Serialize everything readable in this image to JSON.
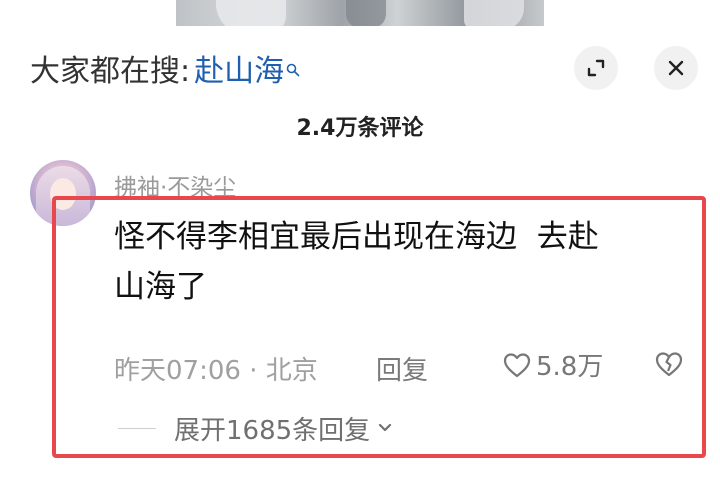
{
  "search_header": {
    "prefix": "大家都在搜:",
    "keyword": "赴山海",
    "icons": [
      "search-icon",
      "expand-icon",
      "close-icon"
    ]
  },
  "comment_count": "2.4万条评论",
  "comment": {
    "username": "拂袖·不染尘",
    "text": "怪不得李相宜最后出现在海边  去赴\n山海了",
    "time_location": "昨天07:06 · 北京",
    "reply_label": "回复",
    "like_count": "5.8万",
    "expand_replies": "展开1685条回复"
  },
  "colors": {
    "keyword": "#1f5fb0",
    "highlight_border": "#e8474c"
  }
}
